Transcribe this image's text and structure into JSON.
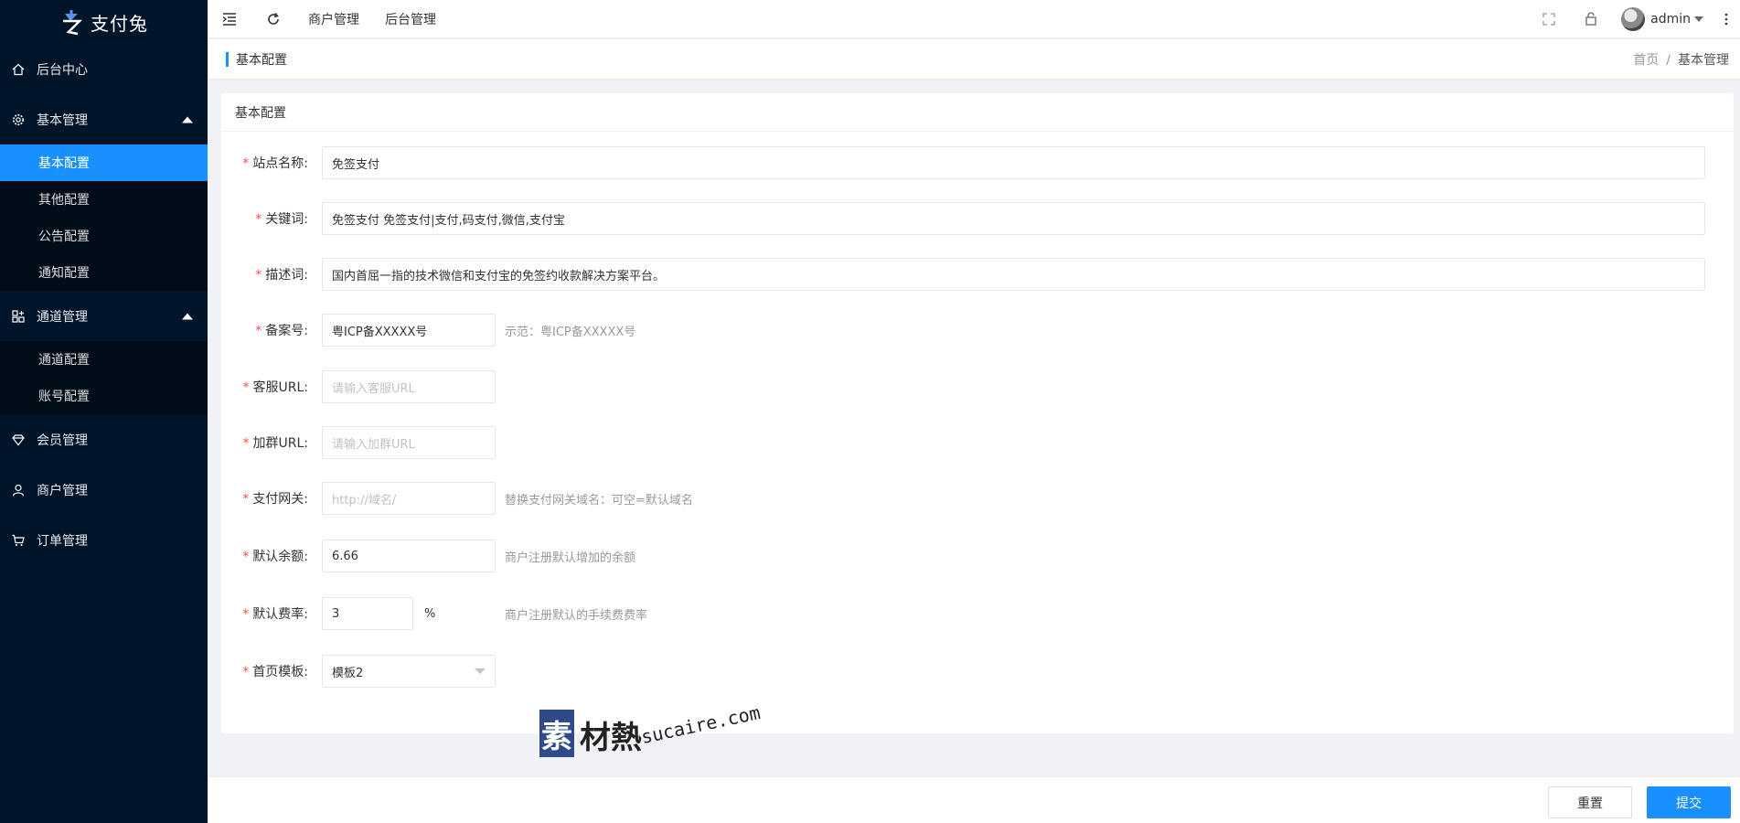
{
  "app": {
    "logo_text": "支付兔"
  },
  "sidebar": {
    "items": [
      {
        "label": "后台中心",
        "icon": "home-icon"
      },
      {
        "label": "基本管理",
        "icon": "gear-icon",
        "expanded": true,
        "children": [
          "基本配置",
          "其他配置",
          "公告配置",
          "通知配置"
        ]
      },
      {
        "label": "通道管理",
        "icon": "apps-icon",
        "expanded": true,
        "children": [
          "通道配置",
          "账号配置"
        ]
      },
      {
        "label": "会员管理",
        "icon": "diamond-icon"
      },
      {
        "label": "商户管理",
        "icon": "user-icon"
      },
      {
        "label": "订单管理",
        "icon": "cart-icon"
      }
    ],
    "active_child": "基本配置"
  },
  "header": {
    "links": [
      "商户管理",
      "后台管理"
    ],
    "username": "admin"
  },
  "titlebar": {
    "title": "基本配置",
    "breadcrumb": [
      "首页",
      "/",
      "基本管理"
    ]
  },
  "card": {
    "title": "基本配置"
  },
  "form": {
    "site_name": {
      "label": "站点名称:",
      "value": "免签支付"
    },
    "keywords": {
      "label": "关键词:",
      "value": "免签支付 免签支付|支付,码支付,微信,支付宝"
    },
    "description": {
      "label": "描述词:",
      "value": "国内首屈一指的技术微信和支付宝的免签约收款解决方案平台。"
    },
    "icp": {
      "label": "备案号:",
      "value": "粤ICP备XXXXX号",
      "hint": "示范：粤ICP备XXXXX号"
    },
    "service_url": {
      "label": "客服URL:",
      "placeholder": "请输入客服URL"
    },
    "group_url": {
      "label": "加群URL:",
      "placeholder": "请输入加群URL"
    },
    "gateway": {
      "label": "支付网关:",
      "placeholder": "http://域名/",
      "hint": "替换支付网关域名：可空=默认域名"
    },
    "default_balance": {
      "label": "默认余额:",
      "value": "6.66",
      "hint": "商户注册默认增加的余额"
    },
    "default_rate": {
      "label": "默认费率:",
      "value": "3",
      "unit": "%",
      "hint": "商户注册默认的手续费费率"
    },
    "home_template": {
      "label": "首页模板:",
      "value": "模板2"
    }
  },
  "actions": {
    "reset": "重置",
    "submit": "提交"
  },
  "watermark": {
    "chars": [
      "素",
      "材熱"
    ],
    "url": "sucaire.com"
  },
  "colors": {
    "sidebar_bg": "#001529",
    "accent": "#1890ff",
    "required": "#ff4d4f"
  }
}
